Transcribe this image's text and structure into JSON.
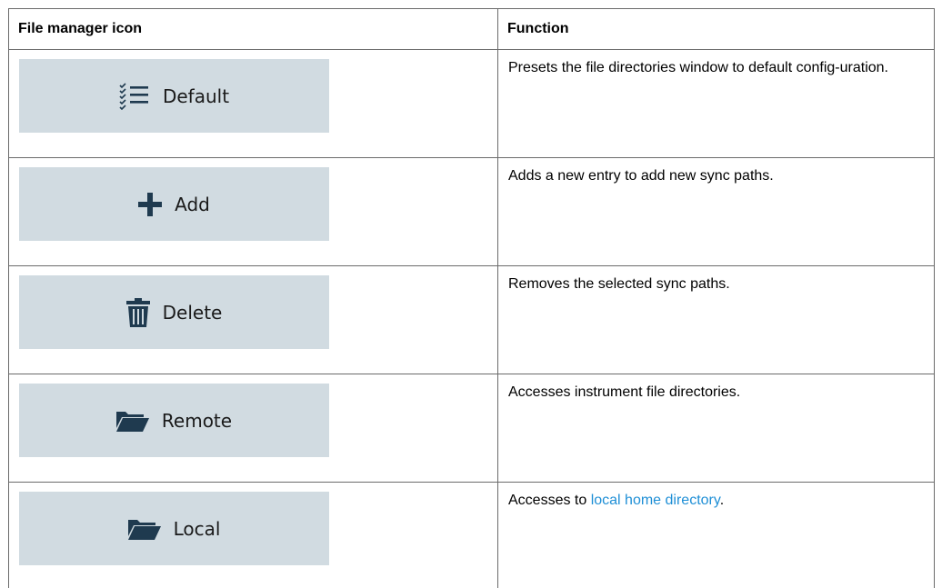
{
  "table": {
    "headers": [
      "File manager icon",
      "Function"
    ],
    "rows": [
      {
        "icon": "checklist-icon",
        "label": "Default",
        "desc": "Presets the file directories window to default config-uration."
      },
      {
        "icon": "plus-icon",
        "label": "Add",
        "desc": "Adds a new entry to add new sync paths."
      },
      {
        "icon": "trash-icon",
        "label": "Delete",
        "desc": "Removes the selected sync paths."
      },
      {
        "icon": "folder-icon",
        "label": "Remote",
        "desc": "Accesses instrument file directories."
      },
      {
        "icon": "folder-icon",
        "label": "Local",
        "desc_prefix": "Accesses to ",
        "desc_link": "local home directory",
        "desc_suffix": "."
      }
    ]
  },
  "colors": {
    "button_bg": "#d1dbe1",
    "icon": "#1f3a4f",
    "link": "#1f8fd6"
  }
}
